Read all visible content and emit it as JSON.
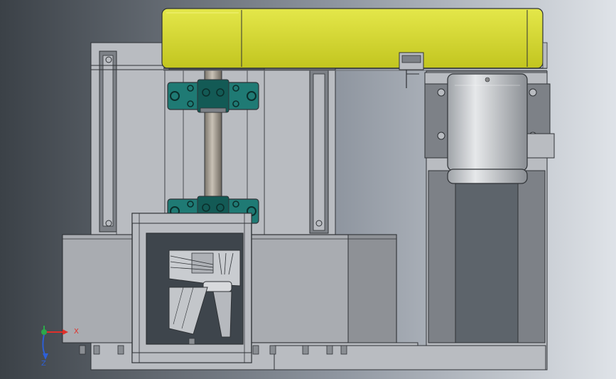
{
  "viewport": {
    "background_gradient": [
      "#3b4147",
      "#8f96a0",
      "#dfe3e8"
    ]
  },
  "colors": {
    "frame": "#b9bcc1",
    "frame_dark": "#7d8187",
    "edge": "#2f3236",
    "belt_guard": "#d9dd2f",
    "belt_guard_shade": "#bfc21f",
    "bearing": "#1f7a74",
    "bearing_shade": "#135a55",
    "motor_body": "#c9cccf",
    "motor_shade": "#8e9297",
    "shaft": "#9b9488",
    "housing": "#a9acb1",
    "housing_dark": "#8e9196",
    "impeller": "#d3d5d8"
  },
  "triad": {
    "x_label": "X",
    "y_label": "Y",
    "z_label": "Z",
    "x_color": "#e0302a",
    "y_color": "#2ca84a",
    "z_color": "#2d5fd6"
  }
}
